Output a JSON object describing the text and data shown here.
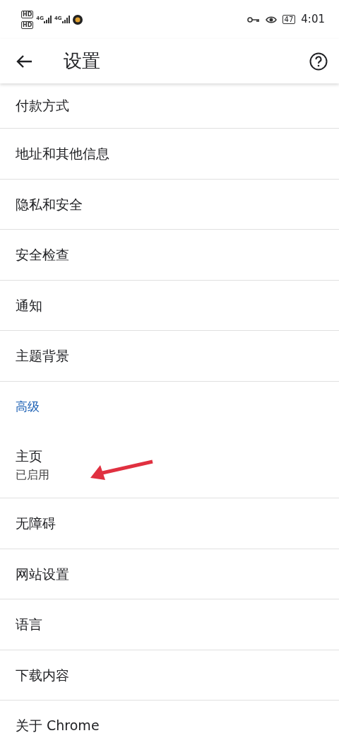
{
  "status_bar": {
    "sim_badges": [
      "HD",
      "HD"
    ],
    "network_labels": [
      "4G",
      "4G"
    ],
    "battery": "47",
    "time": "4:01"
  },
  "toolbar": {
    "title": "设置"
  },
  "items": [
    {
      "kind": "item",
      "title": "付款方式"
    },
    {
      "kind": "item",
      "title": "地址和其他信息"
    },
    {
      "kind": "item",
      "title": "隐私和安全"
    },
    {
      "kind": "item",
      "title": "安全检查"
    },
    {
      "kind": "item",
      "title": "通知"
    },
    {
      "kind": "item",
      "title": "主题背景"
    },
    {
      "kind": "header",
      "title": "高级"
    },
    {
      "kind": "item",
      "title": "主页",
      "subtitle": "已启用",
      "annotated": true
    },
    {
      "kind": "item",
      "title": "无障碍"
    },
    {
      "kind": "item",
      "title": "网站设置"
    },
    {
      "kind": "item",
      "title": "语言"
    },
    {
      "kind": "item",
      "title": "下载内容"
    },
    {
      "kind": "item",
      "title": "关于 Chrome"
    }
  ]
}
